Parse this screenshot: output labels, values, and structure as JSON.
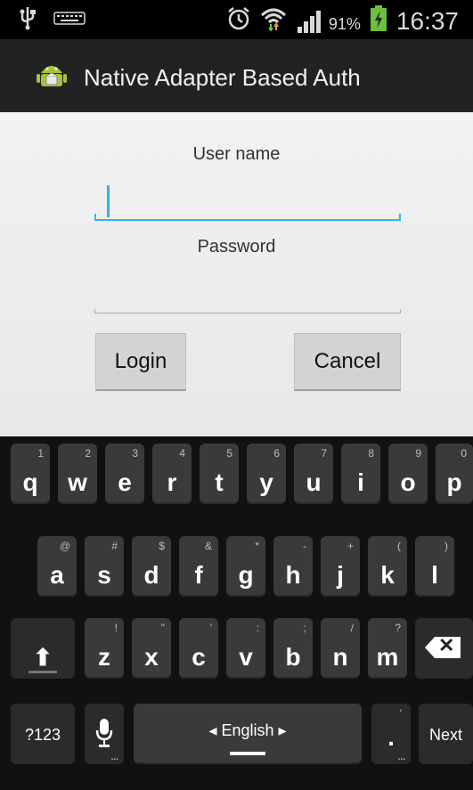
{
  "status": {
    "time": "16:37",
    "battery_percent": "91%",
    "icons": [
      "usb-icon",
      "keyboard-icon",
      "alarm-icon",
      "wifi-icon",
      "signal-icon",
      "battery-icon"
    ]
  },
  "app": {
    "title": "Native Adapter Based Auth",
    "icon": "android-icon"
  },
  "form": {
    "username_label": "User name",
    "username_value": "",
    "password_label": "Password",
    "password_value": "",
    "login_label": "Login",
    "cancel_label": "Cancel"
  },
  "keyboard": {
    "row1": [
      {
        "key": "q",
        "hint": "1"
      },
      {
        "key": "w",
        "hint": "2"
      },
      {
        "key": "e",
        "hint": "3"
      },
      {
        "key": "r",
        "hint": "4"
      },
      {
        "key": "t",
        "hint": "5"
      },
      {
        "key": "y",
        "hint": "6"
      },
      {
        "key": "u",
        "hint": "7"
      },
      {
        "key": "i",
        "hint": "8"
      },
      {
        "key": "o",
        "hint": "9"
      },
      {
        "key": "p",
        "hint": "0"
      }
    ],
    "row2": [
      {
        "key": "a",
        "hint": "@"
      },
      {
        "key": "s",
        "hint": "#"
      },
      {
        "key": "d",
        "hint": "$"
      },
      {
        "key": "f",
        "hint": "&"
      },
      {
        "key": "g",
        "hint": "*"
      },
      {
        "key": "h",
        "hint": "-"
      },
      {
        "key": "j",
        "hint": "+"
      },
      {
        "key": "k",
        "hint": "("
      },
      {
        "key": "l",
        "hint": ")"
      }
    ],
    "row3": [
      {
        "key": "z",
        "hint": "!"
      },
      {
        "key": "x",
        "hint": "\""
      },
      {
        "key": "c",
        "hint": "'"
      },
      {
        "key": "v",
        "hint": ":"
      },
      {
        "key": "b",
        "hint": ";"
      },
      {
        "key": "n",
        "hint": "/"
      },
      {
        "key": "m",
        "hint": "?"
      }
    ],
    "symbols_label": "?123",
    "language_label": "◂ English ▸",
    "period_label": ".",
    "next_label": "Next",
    "backspace_glyph": "✕",
    "shift_glyph": "⬆"
  },
  "colors": {
    "accent": "#33b5e5",
    "key_bg": "#3a3a3a",
    "actionbar": "#222222"
  }
}
